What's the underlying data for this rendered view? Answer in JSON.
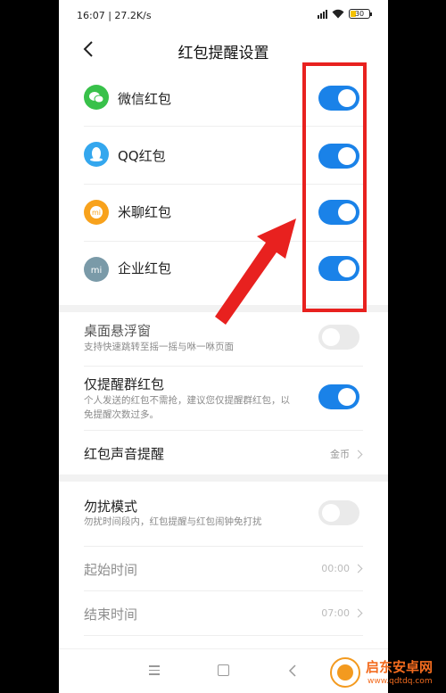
{
  "status": {
    "time": "16:07",
    "speed": "27.2K/s",
    "battery": "30",
    "battery_level": 0.3
  },
  "header": {
    "title": "红包提醒设置"
  },
  "apps": [
    {
      "label": "微信红包",
      "icon": "wechat-icon",
      "color": "#38c14a",
      "enabled": true
    },
    {
      "label": "QQ红包",
      "icon": "qq-icon",
      "color": "#34a7ee",
      "enabled": true
    },
    {
      "label": "米聊红包",
      "icon": "miliao-icon",
      "color": "#f8a21c",
      "enabled": true
    },
    {
      "label": "企业红包",
      "icon": "mi-icon",
      "color": "#7a9aa8",
      "enabled": true
    }
  ],
  "settings": {
    "float": {
      "title": "桌面悬浮窗",
      "subtitle": "支持快速跳转至摇一摇与咻一咻页面",
      "enabled": false
    },
    "group_only": {
      "title": "仅提醒群红包",
      "subtitle": "个人发送的红包不需抢，建议您仅提醒群红包，以免提醒次数过多。",
      "enabled": true
    },
    "sound": {
      "title": "红包声音提醒",
      "value": "金币"
    },
    "dnd": {
      "title": "勿扰模式",
      "subtitle": "勿扰时间段内，红包提醒与红包闹钟免打扰",
      "enabled": false
    },
    "start": {
      "title": "起始时间",
      "value": "00:00"
    },
    "end": {
      "title": "结束时间",
      "value": "07:00"
    }
  },
  "watermark": {
    "name": "启东安卓网",
    "url": "www.qdtdq.com"
  },
  "colors": {
    "accent": "#1a82e8",
    "highlight": "#e8211f"
  }
}
